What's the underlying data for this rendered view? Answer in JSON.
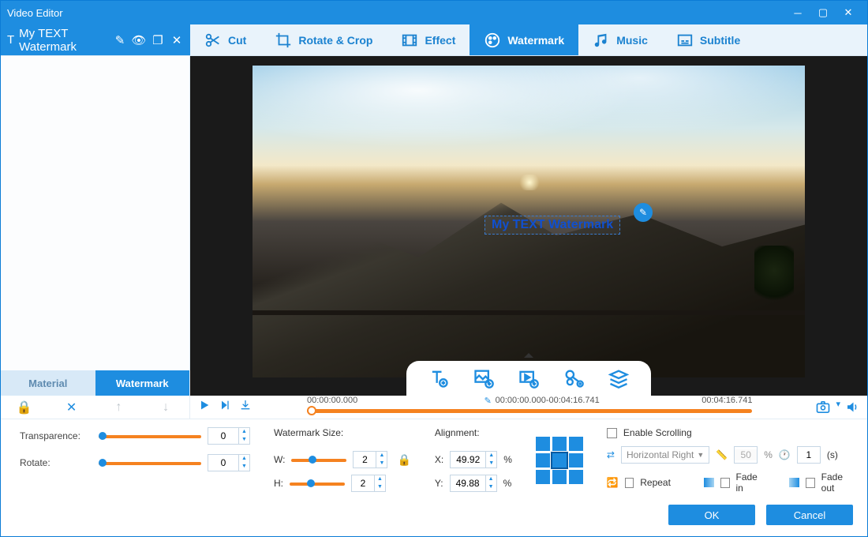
{
  "window": {
    "title": "Video Editor"
  },
  "layer": {
    "text": "My TEXT Watermark"
  },
  "toolbar": {
    "cut": "Cut",
    "rotate": "Rotate & Crop",
    "effect": "Effect",
    "watermark": "Watermark",
    "music": "Music",
    "subtitle": "Subtitle"
  },
  "sidebar_tabs": {
    "material": "Material",
    "watermark": "Watermark"
  },
  "overlay_text": "My TEXT Watermark",
  "timeline": {
    "start": "00:00:00.000",
    "range": "00:00:00.000-00:04:16.741",
    "end": "00:04:16.741"
  },
  "controls": {
    "transparence_label": "Transparence:",
    "transparence_value": "0",
    "rotate_label": "Rotate:",
    "rotate_value": "0",
    "size_label": "Watermark Size:",
    "w_label": "W:",
    "w_value": "2",
    "h_label": "H:",
    "h_value": "2",
    "align_label": "Alignment:",
    "x_label": "X:",
    "x_value": "49.92",
    "y_label": "Y:",
    "y_value": "49.88",
    "pct": "%",
    "enable_scroll": "Enable Scrolling",
    "direction": "Horizontal Right",
    "dist_value": "50",
    "time_value": "1",
    "time_unit": "(s)",
    "repeat": "Repeat",
    "fadein": "Fade in",
    "fadeout": "Fade out"
  },
  "footer": {
    "ok": "OK",
    "cancel": "Cancel"
  }
}
